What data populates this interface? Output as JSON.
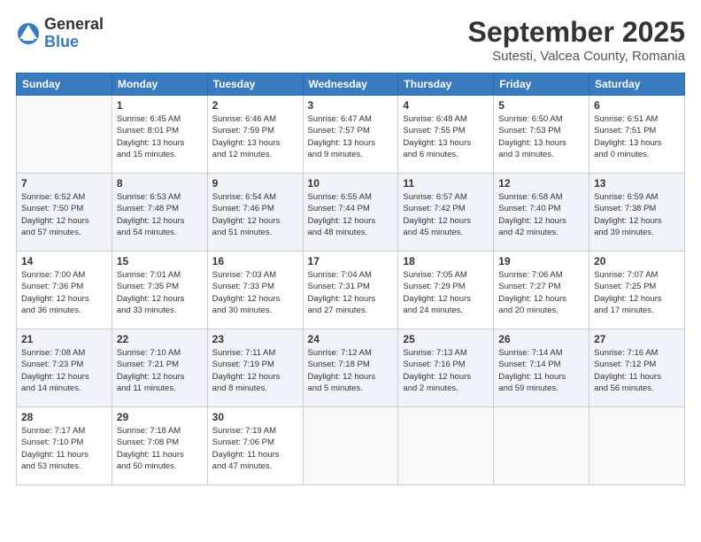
{
  "logo": {
    "general": "General",
    "blue": "Blue"
  },
  "title": "September 2025",
  "subtitle": "Sutesti, Valcea County, Romania",
  "days_of_week": [
    "Sunday",
    "Monday",
    "Tuesday",
    "Wednesday",
    "Thursday",
    "Friday",
    "Saturday"
  ],
  "weeks": [
    [
      {
        "day": "",
        "info": ""
      },
      {
        "day": "1",
        "info": "Sunrise: 6:45 AM\nSunset: 8:01 PM\nDaylight: 13 hours\nand 15 minutes."
      },
      {
        "day": "2",
        "info": "Sunrise: 6:46 AM\nSunset: 7:59 PM\nDaylight: 13 hours\nand 12 minutes."
      },
      {
        "day": "3",
        "info": "Sunrise: 6:47 AM\nSunset: 7:57 PM\nDaylight: 13 hours\nand 9 minutes."
      },
      {
        "day": "4",
        "info": "Sunrise: 6:48 AM\nSunset: 7:55 PM\nDaylight: 13 hours\nand 6 minutes."
      },
      {
        "day": "5",
        "info": "Sunrise: 6:50 AM\nSunset: 7:53 PM\nDaylight: 13 hours\nand 3 minutes."
      },
      {
        "day": "6",
        "info": "Sunrise: 6:51 AM\nSunset: 7:51 PM\nDaylight: 13 hours\nand 0 minutes."
      }
    ],
    [
      {
        "day": "7",
        "info": "Sunrise: 6:52 AM\nSunset: 7:50 PM\nDaylight: 12 hours\nand 57 minutes."
      },
      {
        "day": "8",
        "info": "Sunrise: 6:53 AM\nSunset: 7:48 PM\nDaylight: 12 hours\nand 54 minutes."
      },
      {
        "day": "9",
        "info": "Sunrise: 6:54 AM\nSunset: 7:46 PM\nDaylight: 12 hours\nand 51 minutes."
      },
      {
        "day": "10",
        "info": "Sunrise: 6:55 AM\nSunset: 7:44 PM\nDaylight: 12 hours\nand 48 minutes."
      },
      {
        "day": "11",
        "info": "Sunrise: 6:57 AM\nSunset: 7:42 PM\nDaylight: 12 hours\nand 45 minutes."
      },
      {
        "day": "12",
        "info": "Sunrise: 6:58 AM\nSunset: 7:40 PM\nDaylight: 12 hours\nand 42 minutes."
      },
      {
        "day": "13",
        "info": "Sunrise: 6:59 AM\nSunset: 7:38 PM\nDaylight: 12 hours\nand 39 minutes."
      }
    ],
    [
      {
        "day": "14",
        "info": "Sunrise: 7:00 AM\nSunset: 7:36 PM\nDaylight: 12 hours\nand 36 minutes."
      },
      {
        "day": "15",
        "info": "Sunrise: 7:01 AM\nSunset: 7:35 PM\nDaylight: 12 hours\nand 33 minutes."
      },
      {
        "day": "16",
        "info": "Sunrise: 7:03 AM\nSunset: 7:33 PM\nDaylight: 12 hours\nand 30 minutes."
      },
      {
        "day": "17",
        "info": "Sunrise: 7:04 AM\nSunset: 7:31 PM\nDaylight: 12 hours\nand 27 minutes."
      },
      {
        "day": "18",
        "info": "Sunrise: 7:05 AM\nSunset: 7:29 PM\nDaylight: 12 hours\nand 24 minutes."
      },
      {
        "day": "19",
        "info": "Sunrise: 7:06 AM\nSunset: 7:27 PM\nDaylight: 12 hours\nand 20 minutes."
      },
      {
        "day": "20",
        "info": "Sunrise: 7:07 AM\nSunset: 7:25 PM\nDaylight: 12 hours\nand 17 minutes."
      }
    ],
    [
      {
        "day": "21",
        "info": "Sunrise: 7:08 AM\nSunset: 7:23 PM\nDaylight: 12 hours\nand 14 minutes."
      },
      {
        "day": "22",
        "info": "Sunrise: 7:10 AM\nSunset: 7:21 PM\nDaylight: 12 hours\nand 11 minutes."
      },
      {
        "day": "23",
        "info": "Sunrise: 7:11 AM\nSunset: 7:19 PM\nDaylight: 12 hours\nand 8 minutes."
      },
      {
        "day": "24",
        "info": "Sunrise: 7:12 AM\nSunset: 7:18 PM\nDaylight: 12 hours\nand 5 minutes."
      },
      {
        "day": "25",
        "info": "Sunrise: 7:13 AM\nSunset: 7:16 PM\nDaylight: 12 hours\nand 2 minutes."
      },
      {
        "day": "26",
        "info": "Sunrise: 7:14 AM\nSunset: 7:14 PM\nDaylight: 11 hours\nand 59 minutes."
      },
      {
        "day": "27",
        "info": "Sunrise: 7:16 AM\nSunset: 7:12 PM\nDaylight: 11 hours\nand 56 minutes."
      }
    ],
    [
      {
        "day": "28",
        "info": "Sunrise: 7:17 AM\nSunset: 7:10 PM\nDaylight: 11 hours\nand 53 minutes."
      },
      {
        "day": "29",
        "info": "Sunrise: 7:18 AM\nSunset: 7:08 PM\nDaylight: 11 hours\nand 50 minutes."
      },
      {
        "day": "30",
        "info": "Sunrise: 7:19 AM\nSunset: 7:06 PM\nDaylight: 11 hours\nand 47 minutes."
      },
      {
        "day": "",
        "info": ""
      },
      {
        "day": "",
        "info": ""
      },
      {
        "day": "",
        "info": ""
      },
      {
        "day": "",
        "info": ""
      }
    ]
  ]
}
